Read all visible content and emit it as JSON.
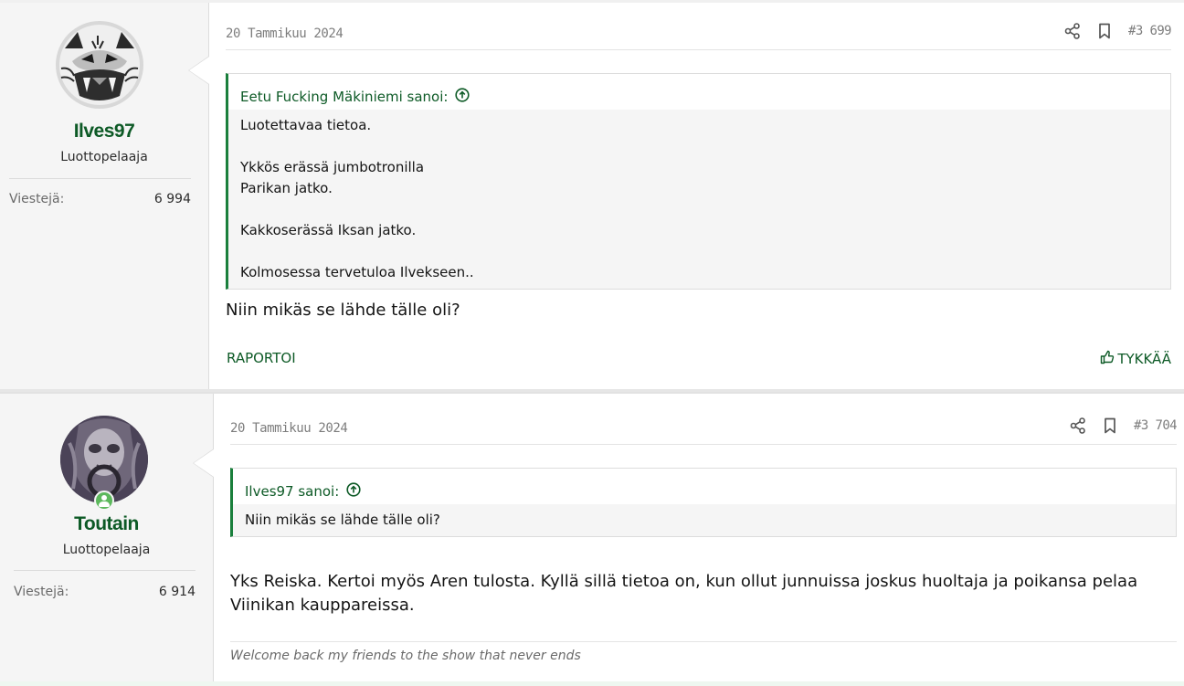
{
  "posts": [
    {
      "user": {
        "name": "Ilves97",
        "title": "Luottopelaaja",
        "stat_label": "Viestejä:",
        "stat_value": "6 994"
      },
      "date": "20 Tammikuu 2024",
      "post_number": "#3 699",
      "quote": {
        "author": "Eetu Fucking Mäkiniemi sanoi:",
        "lines": [
          "Luotettavaa tietoa.",
          "",
          "Ykkös erässä jumbotronilla",
          "Parikan jatko.",
          "",
          "Kakkoserässä Iksan jatko.",
          "",
          "Kolmosessa tervetuloa Ilvekseen.."
        ]
      },
      "message": "Niin mikäs se lähde tälle oli?",
      "actions": {
        "report": "RAPORTOI",
        "like": "TYKKÄÄ"
      }
    },
    {
      "user": {
        "name": "Toutain",
        "title": "Luottopelaaja",
        "stat_label": "Viestejä:",
        "stat_value": "6 914"
      },
      "date": "20 Tammikuu 2024",
      "post_number": "#3 704",
      "quote": {
        "author": "Ilves97 sanoi:",
        "lines": [
          "Niin mikäs se lähde tälle oli?"
        ]
      },
      "message": "Yks Reiska. Kertoi myös Aren tulosta. Kyllä sillä tietoa on, kun ollut junnuissa joskus huoltaja ja poikansa pelaa Viinikan kauppareissa.",
      "signature": "Welcome back my friends to the show that never ends"
    }
  ],
  "colors": {
    "accent": "#0d5a26",
    "quote_border": "#1a7f3c",
    "online": "#5cb85c"
  }
}
